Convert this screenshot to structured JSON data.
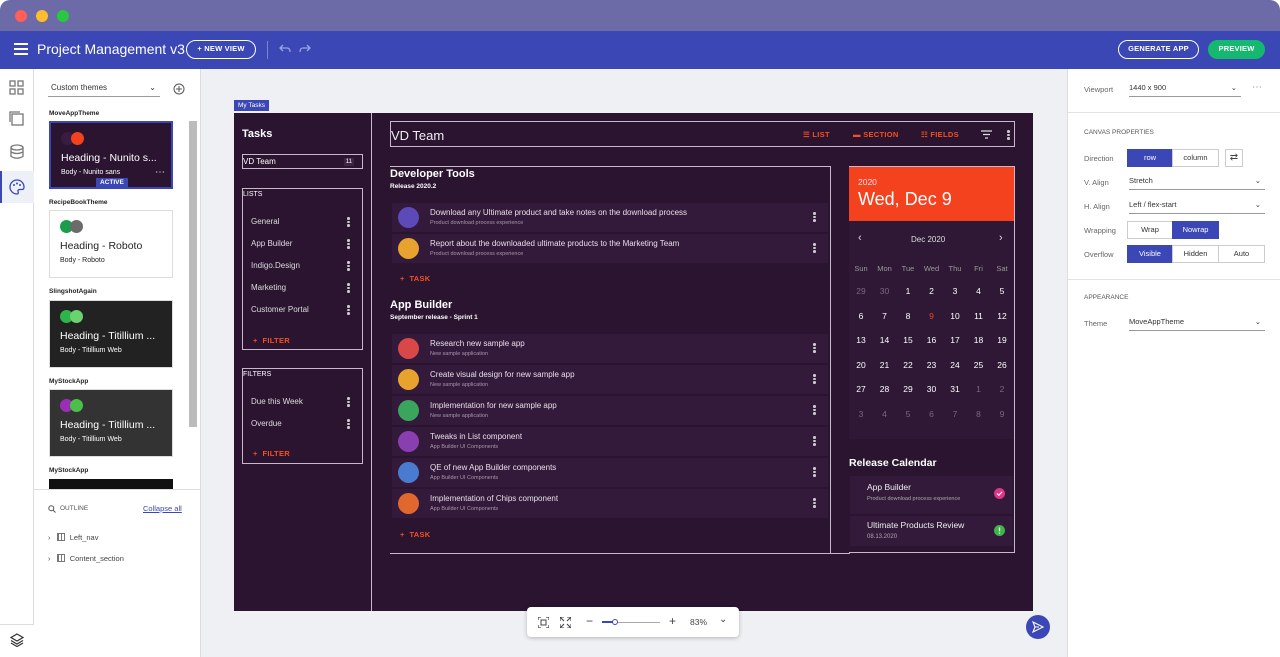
{
  "app": {
    "title": "Project Management v3",
    "new_view": "+ NEW VIEW",
    "generate": "GENERATE APP",
    "preview": "PREVIEW"
  },
  "themes": {
    "dropdown": "Custom themes",
    "items": [
      {
        "name": "MoveAppTheme",
        "heading": "Heading - Nunito s...",
        "body": "Body - Nunito sans",
        "badge": "ACTIVE"
      },
      {
        "name": "RecipeBookTheme",
        "heading": "Heading - Roboto",
        "body": "Body - Roboto"
      },
      {
        "name": "SlingshotAgain",
        "heading": "Heading - Titillium ...",
        "body": "Body - Titillium Web"
      },
      {
        "name": "MyStockApp",
        "heading": "Heading - Titillium ...",
        "body": "Body - Titillium Web"
      },
      {
        "name": "MyStockApp"
      }
    ]
  },
  "outline": {
    "label": "OUTLINE",
    "collapse": "Collapse all",
    "nodes": [
      "Left_nav",
      "Content_section"
    ]
  },
  "canvas": {
    "tag": "My Tasks",
    "nav": {
      "title": "Tasks",
      "team": "VD Team",
      "team_count": "11",
      "lists_label": "LISTS",
      "lists": [
        "General",
        "App Builder",
        "Indigo.Design",
        "Marketing",
        "Customer Portal"
      ],
      "filter": "FILTER",
      "filters_label": "FILTERS",
      "filters": [
        "Due this Week",
        "Overdue"
      ]
    },
    "header": {
      "team": "VD Team",
      "list": "LIST",
      "section": "SECTION",
      "fields": "FIELDS"
    },
    "sections": [
      {
        "title": "Developer Tools",
        "subtitle": "Release 2020.2",
        "tasks": [
          {
            "title": "Download any Ultimate product and take notes on the download process",
            "sub": "Product download process experience"
          },
          {
            "title": "Report about the downloaded ultimate products to the Marketing Team",
            "sub": "Product download process experience"
          }
        ]
      },
      {
        "title": "App Builder",
        "subtitle": "September release - Sprint 1",
        "tasks": [
          {
            "title": "Research new sample app",
            "sub": "New sample application"
          },
          {
            "title": "Create visual design for new sample app",
            "sub": "New sample application"
          },
          {
            "title": "Implementation for new sample app",
            "sub": "New sample application"
          },
          {
            "title": "Tweaks in List component",
            "sub": "App Builder UI Components"
          },
          {
            "title": "QE of new App Builder components",
            "sub": "App Builder UI Components"
          },
          {
            "title": "Implementation of Chips component",
            "sub": "App Builder UI Components"
          }
        ]
      }
    ],
    "task_btn": "TASK",
    "calendar": {
      "year": "2020",
      "date": "Wed, Dec 9",
      "month": "Dec 2020",
      "weekdays": [
        "Sun",
        "Mon",
        "Tue",
        "Wed",
        "Thu",
        "Fri",
        "Sat"
      ],
      "weeks": [
        [
          "29",
          "30",
          "1",
          "2",
          "3",
          "4",
          "5"
        ],
        [
          "6",
          "7",
          "8",
          "9",
          "10",
          "11",
          "12"
        ],
        [
          "13",
          "14",
          "15",
          "16",
          "17",
          "18",
          "19"
        ],
        [
          "20",
          "21",
          "22",
          "23",
          "24",
          "25",
          "26"
        ],
        [
          "27",
          "28",
          "29",
          "30",
          "31",
          "1",
          "2"
        ],
        [
          "3",
          "4",
          "5",
          "6",
          "7",
          "8",
          "9"
        ]
      ],
      "release_title": "Release Calendar",
      "events": [
        {
          "title": "App Builder",
          "sub": "Product download process experience"
        },
        {
          "title": "Ultimate Products Review",
          "sub": "08.13.2020"
        }
      ]
    }
  },
  "zoom": {
    "value": "83%"
  },
  "props": {
    "viewport_label": "Viewport",
    "viewport": "1440 x 900",
    "canvas_props": "CANVAS PROPERTIES",
    "direction": "Direction",
    "row": "row",
    "column": "column",
    "valign": "V. Align",
    "valign_val": "Stretch",
    "halign": "H. Align",
    "halign_val": "Left / flex-start",
    "wrapping": "Wrapping",
    "wrap": "Wrap",
    "nowrap": "Nowrap",
    "overflow": "Overflow",
    "visible": "Visible",
    "hidden": "Hidden",
    "auto": "Auto",
    "appearance": "APPEARANCE",
    "theme": "Theme",
    "theme_val": "MoveAppTheme"
  },
  "colors": {
    "accent": "#3a47b4",
    "canvas_bg": "#2a1430",
    "orange": "#f4411e",
    "green": "#14b86e"
  }
}
